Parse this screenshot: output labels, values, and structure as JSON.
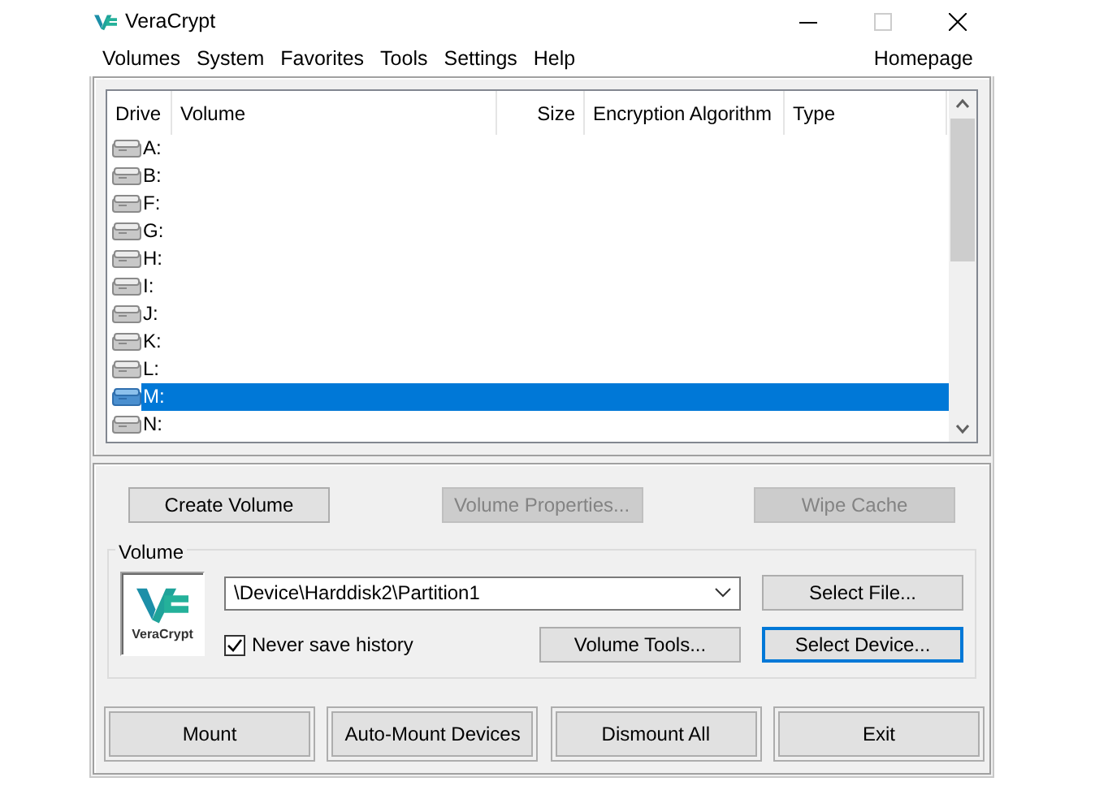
{
  "window": {
    "title": "VeraCrypt"
  },
  "menu": [
    {
      "label": "Volumes"
    },
    {
      "label": "System"
    },
    {
      "label": "Favorites"
    },
    {
      "label": "Tools"
    },
    {
      "label": "Settings"
    },
    {
      "label": "Help"
    }
  ],
  "homepage": "Homepage",
  "drive_list": {
    "columns": [
      "Drive",
      "Volume",
      "Size",
      "Encryption Algorithm",
      "Type"
    ],
    "rows": [
      {
        "drive": "A:",
        "selected": false
      },
      {
        "drive": "B:",
        "selected": false
      },
      {
        "drive": "F:",
        "selected": false
      },
      {
        "drive": "G:",
        "selected": false
      },
      {
        "drive": "H:",
        "selected": false
      },
      {
        "drive": "I:",
        "selected": false
      },
      {
        "drive": "J:",
        "selected": false
      },
      {
        "drive": "K:",
        "selected": false
      },
      {
        "drive": "L:",
        "selected": false
      },
      {
        "drive": "M:",
        "selected": true
      },
      {
        "drive": "N:",
        "selected": false
      }
    ]
  },
  "top_buttons": [
    {
      "label": "Create Volume",
      "disabled": false
    },
    {
      "label": "Volume Properties...",
      "disabled": true
    },
    {
      "label": "Wipe Cache",
      "disabled": true
    }
  ],
  "volume_group": {
    "title": "Volume",
    "logo_text": "VeraCrypt",
    "path": "\\Device\\Harddisk2\\Partition1",
    "never_save_history": {
      "label": "Never save history",
      "checked": true
    },
    "select_file": {
      "label": "Select File...",
      "focused": false
    },
    "volume_tools": {
      "label": "Volume Tools...",
      "focused": false
    },
    "select_device": {
      "label": "Select Device...",
      "focused": true
    }
  },
  "bottom_buttons": [
    {
      "label": "Mount"
    },
    {
      "label": "Auto-Mount Devices"
    },
    {
      "label": "Dismount All"
    },
    {
      "label": "Exit"
    }
  ]
}
